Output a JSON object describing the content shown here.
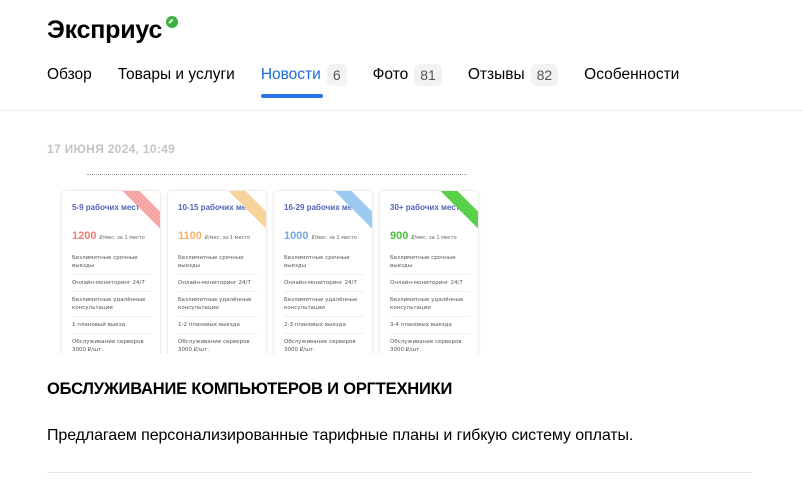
{
  "org": {
    "title": "Эксприус",
    "verified_color": "#3bb13d"
  },
  "tabs": [
    {
      "label": "Обзор",
      "count": ""
    },
    {
      "label": "Товары и услуги",
      "count": ""
    },
    {
      "label": "Новости",
      "count": "6",
      "active": true
    },
    {
      "label": "Фото",
      "count": "81"
    },
    {
      "label": "Отзывы",
      "count": "82"
    },
    {
      "label": "Особенности",
      "count": ""
    }
  ],
  "accent_color": "#2a73e8",
  "post": {
    "date": "17 ИЮНЯ 2024, 10:49",
    "heading": "ОБСЛУЖИВАНИЕ КОМПЬЮТЕРОВ И ОРГТЕХНИКИ",
    "body": "Предлагаем персонализированные тарифные планы и гибкую систему оплаты.",
    "image": {
      "cards": [
        {
          "places": "5-9 рабочих мест",
          "price": "1200",
          "price_unit": "₽/мес. за 1 место",
          "price_color": "#f07a7a",
          "ribbon_color": "#f6a6a6",
          "features": [
            "Безлимитные срочные выезды",
            "Онлайн-мониторинг 24/7",
            "Безлимитные удалённые консультации",
            "1 плановый выезд",
            "Обслуживание серверов 3000 ₽/шт."
          ]
        },
        {
          "places": "10-15 рабочих мест",
          "price": "1100",
          "price_unit": "₽/мес. за 1 место",
          "price_color": "#f5b46a",
          "ribbon_color": "#f9d39c",
          "features": [
            "Безлимитные срочные выезды",
            "Онлайн-мониторинг 24/7",
            "Безлимитные удалённые консультации",
            "1-2 плановых выезда",
            "Обслуживание серверов 3000 ₽/шт."
          ]
        },
        {
          "places": "16-29 рабочих мест",
          "price": "1000",
          "price_unit": "₽/мес. за 1 место",
          "price_color": "#6fa9e8",
          "ribbon_color": "#9ccaf2",
          "features": [
            "Безлимитные срочные выезды",
            "Онлайн-мониторинг 24/7",
            "Безлимитные удалённые консультации",
            "2-3 плановых выезда",
            "Обслуживание серверов 3000 ₽/шт."
          ]
        },
        {
          "places": "30+ рабочих мест",
          "price": "900",
          "price_unit": "₽/мес. за 1 место",
          "price_color": "#4cbf3a",
          "ribbon_color": "#5ad14a",
          "features": [
            "Безлимитные срочные выезды",
            "Онлайн-мониторинг 24/7",
            "Безлимитные удалённые консультации",
            "3-4 плановых выезда",
            "Обслуживание серверов 3000 ₽/шт."
          ]
        }
      ]
    }
  }
}
